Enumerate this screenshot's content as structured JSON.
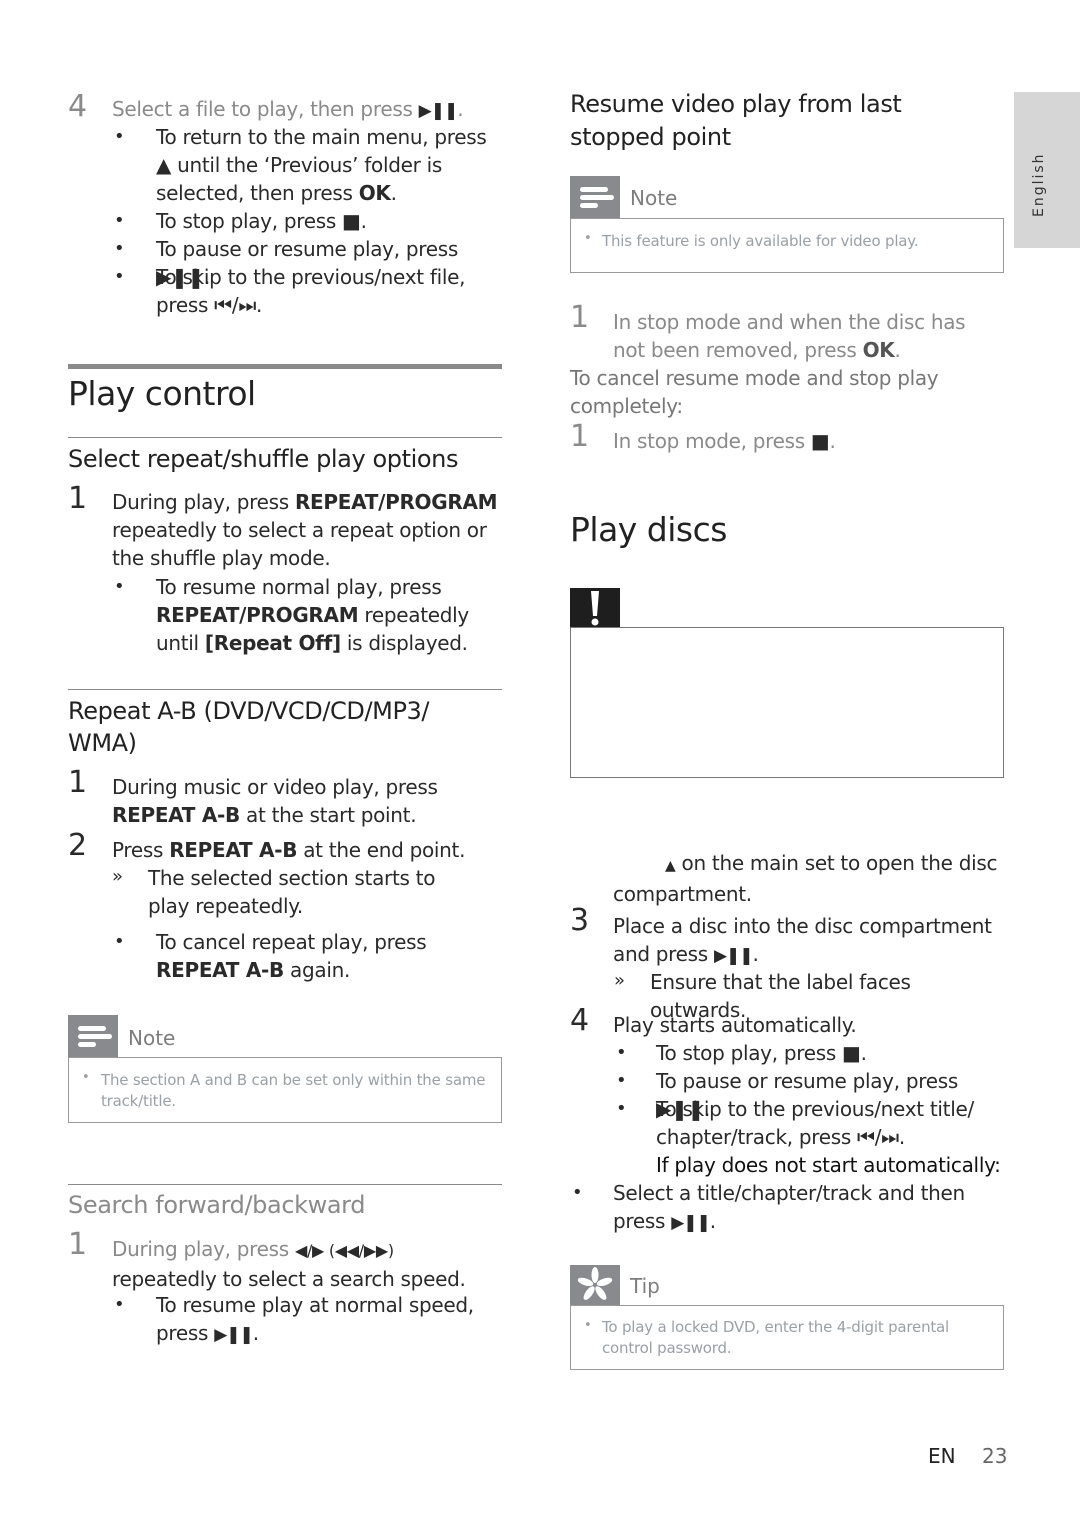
{
  "side_tab": {
    "label": "English"
  },
  "left": {
    "step4": {
      "num": "4",
      "text": "Select a file to play, then press",
      "sym": "▶❚❚",
      "end": ".",
      "bullets": [
        {
          "text": "To return to the main menu, press ▲ until the ‘Previous’ folder is selected, then press",
          "bold": "OK",
          "end": "."
        },
        {
          "text": "To stop play, press ■.",
          "bold": "",
          "end": ""
        },
        {
          "text": "To pause or resume play, press ▶❚❚.",
          "bold": "",
          "end": ""
        },
        {
          "text": "To skip to the previous/next file, press ⏮/⏭.",
          "bold": "",
          "end": ""
        }
      ]
    },
    "play_control": {
      "title": "Play control",
      "repeat_shuffle": {
        "title": "Select repeat/shuffle play options",
        "step1": {
          "num": "1",
          "pre": "During play, press",
          "bold": "REPEAT/PROGRAM",
          "post": "repeatedly to select a repeat option or the shuffle play mode."
        },
        "bullet": {
          "pre": "To resume normal play, press",
          "bold": "REPEAT/PROGRAM",
          "mid": "repeatedly until",
          "bold2": "[Repeat Off]",
          "post": "is displayed."
        }
      },
      "repeat_ab": {
        "title": "Repeat A-B (DVD/VCD/CD/MP3/ WMA)",
        "step1": {
          "num": "1",
          "pre": "During music or video play, press",
          "bold": "REPEAT A-B",
          "post": "at the start point."
        },
        "step2": {
          "num": "2",
          "pre": "Press",
          "bold": "REPEAT A-B",
          "post": "at the end point."
        },
        "result": {
          "marker": "»",
          "text": "The selected section starts to play repeatedly."
        },
        "bullet": {
          "pre": "To cancel repeat play, press",
          "bold": "REPEAT A-B",
          "post": "again."
        }
      },
      "note": {
        "label": "Note",
        "text": "The section A and B can be set only within the same track/title."
      },
      "search": {
        "title": "Search forward/backward",
        "step1": {
          "num": "1",
          "pre": "During play, press",
          "sym": "◀/▶ (◀◀/▶▶)",
          "post": "repeatedly to select a search speed."
        },
        "bullet": {
          "text": "To resume play at normal speed, press",
          "sym": "▶❚❚",
          "end": "."
        }
      }
    }
  },
  "right": {
    "resume": {
      "title": "Resume video play from last stopped point",
      "note": {
        "label": "Note",
        "text": "This feature is only available for video play."
      },
      "step1": {
        "num": "1",
        "pre": "In stop mode and when the disc has not been removed, press",
        "bold": "OK",
        "end": "."
      },
      "cancel_heading": "To cancel resume mode and stop play completely:",
      "step1b": {
        "num": "1",
        "text": "In stop mode, press",
        "sym": "■",
        "end": "."
      }
    },
    "play_discs": {
      "title": "Play discs",
      "caution_icon": "exclamation-icon",
      "step2_tail": {
        "sym": "▲",
        "text": "on the main set to open the disc compartment."
      },
      "step3": {
        "num": "3",
        "text": "Place a disc into the disc compartment and press",
        "sym": "▶❚❚",
        "end": "."
      },
      "step3_result": {
        "marker": "»",
        "text": "Ensure that the label faces outwards."
      },
      "step4": {
        "num": "4",
        "text": "Play starts automatically."
      },
      "step4_bullets": [
        {
          "text": "To stop play, press ■."
        },
        {
          "text": "To pause or resume play, press ▶❚❚."
        },
        {
          "text": "To skip to the previous/next title/ chapter/track, press ⏮/⏭."
        }
      ],
      "if_not_heading": "If play does not start automatically:",
      "if_not_bullet": {
        "text": "Select a title/chapter/track and then press",
        "sym": "▶❚❚",
        "end": "."
      },
      "tip": {
        "label": "Tip",
        "text": "To play a locked DVD, enter the 4-digit parental control password."
      }
    }
  },
  "footer": {
    "lang": "EN",
    "page": "23"
  }
}
